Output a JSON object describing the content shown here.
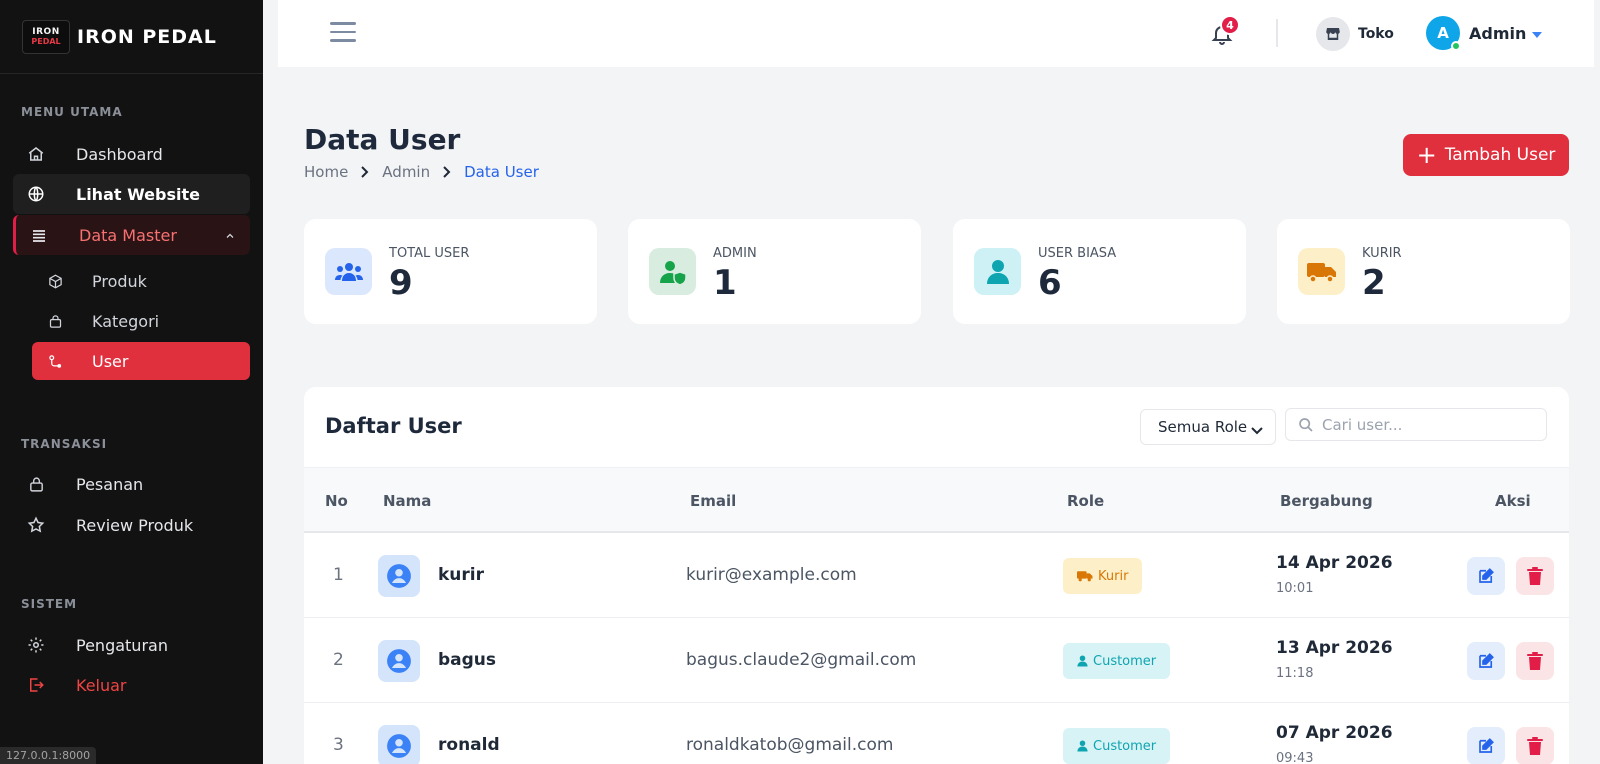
{
  "sidebar": {
    "brand": {
      "name": "IRON PEDAL",
      "logo_text_top": "IRON",
      "logo_text_bottom": "PEDAL"
    },
    "sections": {
      "main": "MENU UTAMA",
      "transaksi": "TRANSAKSI",
      "sistem": "SISTEM"
    },
    "items": {
      "dashboard": "Dashboard",
      "lihat_website": "Lihat Website",
      "data_master": "Data Master",
      "produk": "Produk",
      "kategori": "Kategori",
      "user": "User",
      "pesanan": "Pesanan",
      "review_produk": "Review Produk",
      "pengaturan": "Pengaturan",
      "keluar": "Keluar"
    },
    "status_url": "127.0.0.1:8000"
  },
  "topbar": {
    "notification_count": "4",
    "store_label": "Toko",
    "avatar_initial": "A",
    "user_name": "Admin"
  },
  "page": {
    "title": "Data User",
    "breadcrumb": [
      "Home",
      "Admin",
      "Data User"
    ],
    "add_button": "Tambah User"
  },
  "stats": [
    {
      "label": "TOTAL USER",
      "value": "9"
    },
    {
      "label": "ADMIN",
      "value": "1"
    },
    {
      "label": "USER BIASA",
      "value": "6"
    },
    {
      "label": "KURIR",
      "value": "2"
    }
  ],
  "table": {
    "title": "Daftar User",
    "role_filter": "Semua Role",
    "search_placeholder": "Cari user...",
    "headers": {
      "no": "No",
      "nama": "Nama",
      "email": "Email",
      "role": "Role",
      "bergabung": "Bergabung",
      "aksi": "Aksi"
    },
    "rows": [
      {
        "no": "1",
        "name": "kurir",
        "email": "kurir@example.com",
        "role": "Kurir",
        "date": "14 Apr 2026",
        "time": "10:01"
      },
      {
        "no": "2",
        "name": "bagus",
        "email": "bagus.claude2@gmail.com",
        "role": "Customer",
        "date": "13 Apr 2026",
        "time": "11:18"
      },
      {
        "no": "3",
        "name": "ronald",
        "email": "ronaldkatob@gmail.com",
        "role": "Customer",
        "date": "07 Apr 2026",
        "time": "09:43"
      }
    ]
  },
  "colors": {
    "accent": "#e0303d",
    "sidebar_bg": "#121212",
    "link_blue": "#2563eb",
    "kurir_badge": "#d97706",
    "customer_badge": "#0ea5b0"
  }
}
